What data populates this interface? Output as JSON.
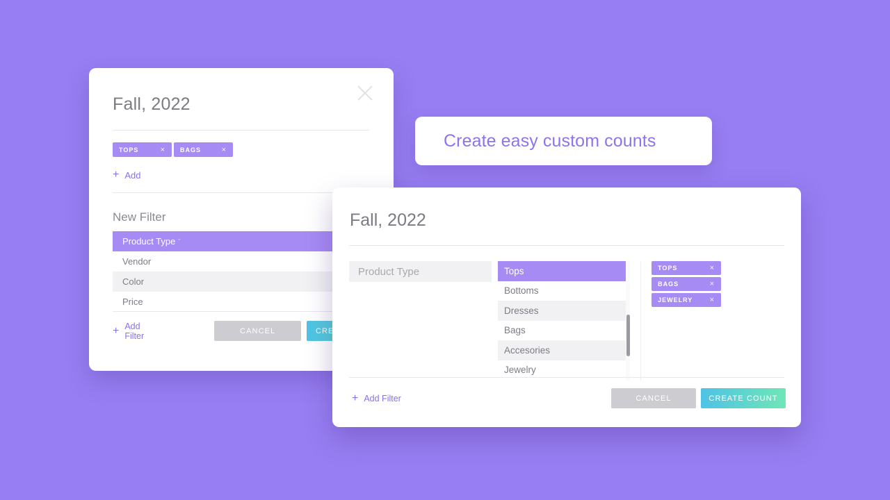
{
  "theme": {
    "background": "#977EF2",
    "accent_purple": "#A78BF5",
    "link_purple": "#8B6FEF",
    "headline_purple": "#8D74EE",
    "cancel_gray": "#CCCCD1",
    "create_gradient_from": "#4EC3E6",
    "create_gradient_to": "#6FE6B6",
    "stripe_gray": "#F1F1F3"
  },
  "headline_card": {
    "text": "Create easy custom counts"
  },
  "back_panel": {
    "title": "Fall, 2022",
    "close_icon": "close-icon",
    "tags": [
      {
        "label": "TOPS",
        "remove": "×"
      },
      {
        "label": "BAGS",
        "remove": "×"
      }
    ],
    "add_link": {
      "plus": "+",
      "label": "Add"
    },
    "section_label": "New Filter",
    "filter_options": [
      {
        "label": "Product Type",
        "caret": "ˇ",
        "selected": true
      },
      {
        "label": "Vendor",
        "selected": false
      },
      {
        "label": "Color",
        "selected": false
      },
      {
        "label": "Price",
        "selected": false
      }
    ],
    "footer": {
      "add_filter": {
        "plus": "+",
        "label": "Add Filter"
      },
      "cancel_label": "CANCEL",
      "create_label": "CREATE COUNT"
    }
  },
  "front_panel": {
    "title": "Fall, 2022",
    "type_input": {
      "placeholder": "Product Type",
      "value": ""
    },
    "dropdown_options": [
      {
        "label": "Tops",
        "selected": true
      },
      {
        "label": "Bottoms",
        "selected": false
      },
      {
        "label": "Dresses",
        "selected": false
      },
      {
        "label": "Bags",
        "selected": false
      },
      {
        "label": "Accesories",
        "selected": false
      },
      {
        "label": "Jewelry",
        "selected": false
      }
    ],
    "tags": [
      {
        "label": "TOPS",
        "remove": "×"
      },
      {
        "label": "BAGS",
        "remove": "×"
      },
      {
        "label": "JEWELRY",
        "remove": "×"
      }
    ],
    "footer": {
      "add_filter": {
        "plus": "+",
        "label": "Add Filter"
      },
      "cancel_label": "CANCEL",
      "create_label": "CREATE COUNT"
    }
  }
}
